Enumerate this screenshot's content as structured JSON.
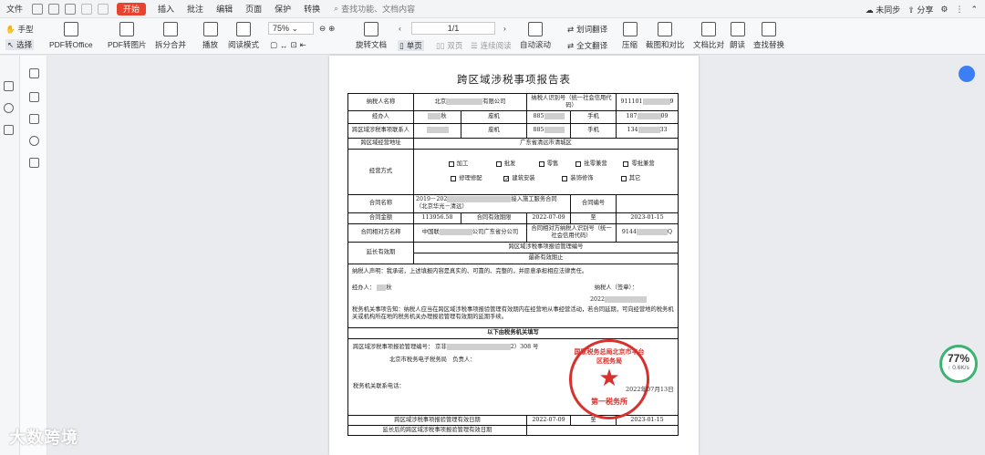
{
  "menubar": {
    "file": "文件",
    "start": "开始",
    "tabs": [
      "插入",
      "批注",
      "编辑",
      "页面",
      "保护",
      "转换"
    ],
    "search": "查找功能、文档内容",
    "sync": "未同步",
    "share": "分享"
  },
  "toolbar": {
    "hand": "手型",
    "select": "选择",
    "pdf_office": "PDF转Office",
    "pdf_image": "PDF转图片",
    "split_merge": "拆分合并",
    "play": "播放",
    "read_mode": "阅读模式",
    "zoom": "75%",
    "page_display": "1/1",
    "rotate": "旋转文档",
    "single": "单页",
    "double": "双页",
    "continuous": "连续阅读",
    "auto_scroll": "自动滚动",
    "word_translate": "划词翻译",
    "full_translate": "全文翻译",
    "compress": "压缩",
    "crop_compare": "截图和对比",
    "doc_compare": "文档比对",
    "read_aloud": "朗读",
    "find_replace": "查找替换"
  },
  "document": {
    "title": "跨区域涉税事项报告表",
    "rows": {
      "taxpayer_name": "纳税人名称",
      "taxpayer_name_val_a": "北京",
      "taxpayer_name_val_b": "有限公司",
      "taxpayer_id": "纳税人识别号（统一社会信用代码）",
      "taxpayer_id_val_a": "911101",
      "taxpayer_id_val_b": "9",
      "agent": "经办人",
      "agent_val": "秋",
      "landline": "座机",
      "landline_val": "885",
      "mobile": "手机",
      "mobile_val_a": "187",
      "mobile_val_b": "09",
      "cross_contact": "跨区域涉税事项联系人",
      "landline_val2": "885",
      "mobile2_val_a": "134",
      "mobile2_val_b": "33",
      "address": "跨区域经营地址",
      "address_val": "广东省清远市清城区",
      "business_mode": "经营方式",
      "options": [
        "加工",
        "批发",
        "零售",
        "批零兼营",
        "零批兼营",
        "修理修配",
        "建筑安装",
        "装饰修饰",
        "其它"
      ],
      "checked_mark": "✓",
      "contract_name": "合同名称",
      "contract_name_val_a": "2019－202",
      "contract_name_val_b": "接入施工服务合同（北京华光－清远）",
      "contract_no": "合同编号",
      "contract_amount": "合同金额",
      "contract_amount_val": "113956.58",
      "contract_period": "合同有效期限",
      "period_start": "2022-07-09",
      "period_to": "至",
      "period_end": "2023-01-15",
      "counterparty": "合同相对方名称",
      "counterparty_val_a": "中国联",
      "counterparty_val_b": "公司广东省分公司",
      "counterparty_id": "合同相对方纳税人识别号（统一社会信用代码）",
      "counterparty_id_val_a": "9144",
      "counterparty_id_val_b": "Q",
      "extension": "延长有效期",
      "verify_no": "跨区域涉税事项报验管理编号",
      "latest_period": "最新有效期止",
      "declaration": "纳税人声明：我承诺，上述填报内容是真实的、可靠的、完整的，并愿意承担相应法律责任。",
      "agent_sign": "经办人：",
      "agent_sign_val": "秋",
      "taxpayer_seal": "纳税人（签章）：",
      "sign_date": "2022",
      "notice": "税务机关事项告知：纳税人应当在跨区域涉税事项报验管理有效期内在经营地从事经营活动，若合同延期，可向经营地的税务机关或机构所在地的税务机关办理报验管理有效期的延期手续。",
      "section_tax": "以下由税务机关填写",
      "verify_no_label": "跨区域涉税事项报验管理编号：",
      "verify_no_val_a": "京非",
      "verify_no_val_b": "2）308 号",
      "authority": "北京市税务电子税务局",
      "responsible": "负责人：",
      "tax_contact": "税务机关联系电话：",
      "valid_date": "跨区域涉税事项报验管理有效日期",
      "valid_start": "2022-07-09",
      "valid_to": "至",
      "valid_end": "2023-01-15",
      "extended_date": "延长后的跨区域涉税事项报验管理有效日期"
    },
    "seal": {
      "ring": "国家税务总局北京市丰台区税务局",
      "bottom": "第一税务所",
      "date": "2022年07月13日"
    }
  },
  "speed": {
    "percent": "77%",
    "rate": "↑ 0.6K/s"
  },
  "watermark": "大数跨境",
  "colors": {
    "start_tab": "#e8432f",
    "seal": "#d8302c",
    "speed_ring": "#3cb371"
  }
}
